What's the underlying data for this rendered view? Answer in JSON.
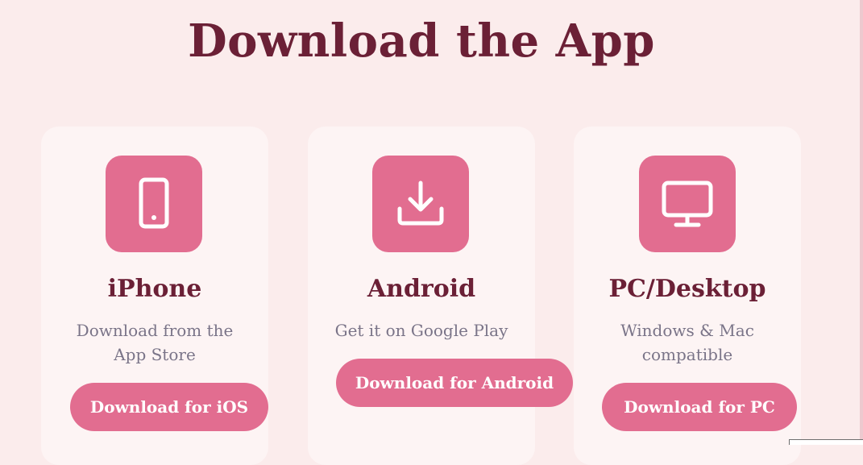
{
  "page": {
    "title": "Download the App"
  },
  "colors": {
    "accent": "#e26d90",
    "heading": "#6b2036",
    "muted": "#7a7488",
    "background": "#fbecec",
    "card": "#fdf4f4"
  },
  "cards": [
    {
      "icon": "smartphone-icon",
      "title": "iPhone",
      "description": "Download from the App Store",
      "button": "Download for iOS"
    },
    {
      "icon": "download-icon",
      "title": "Android",
      "description": "Get it on Google Play",
      "button": "Download for Android"
    },
    {
      "icon": "monitor-icon",
      "title": "PC/Desktop",
      "description": "Windows & Mac compatible",
      "button": "Download for PC"
    }
  ]
}
